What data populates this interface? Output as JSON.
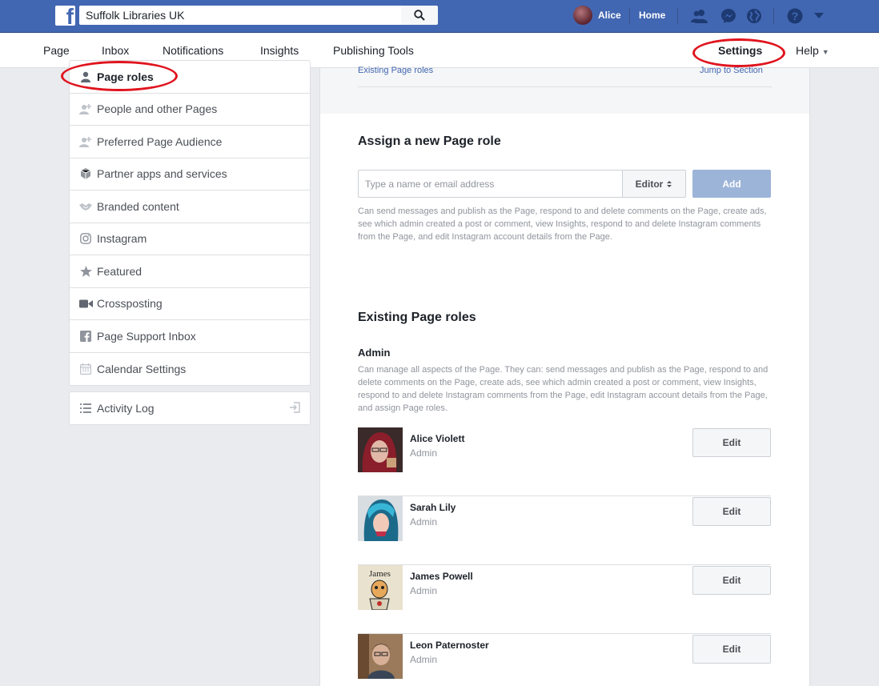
{
  "topbar": {
    "search_value": "Suffolk Libraries UK",
    "user_name": "Alice",
    "home_label": "Home"
  },
  "pagenav": {
    "tabs": [
      "Page",
      "Inbox",
      "Notifications",
      "Insights",
      "Publishing Tools"
    ],
    "settings_label": "Settings",
    "help_label": "Help"
  },
  "sidebar": {
    "items": [
      {
        "label": "Page roles",
        "icon": "person-icon"
      },
      {
        "label": "People and other Pages",
        "icon": "people-add-icon"
      },
      {
        "label": "Preferred Page Audience",
        "icon": "people-add-icon"
      },
      {
        "label": "Partner apps and services",
        "icon": "cube-icon"
      },
      {
        "label": "Branded content",
        "icon": "handshake-icon"
      },
      {
        "label": "Instagram",
        "icon": "instagram-icon"
      },
      {
        "label": "Featured",
        "icon": "star-icon"
      },
      {
        "label": "Crossposting",
        "icon": "video-icon"
      },
      {
        "label": "Page Support Inbox",
        "icon": "facebook-square-icon"
      },
      {
        "label": "Calendar Settings",
        "icon": "calendar-icon"
      }
    ],
    "activity_log": "Activity Log"
  },
  "main": {
    "top_link_left": "Existing Page roles",
    "top_link_right": "Jump to Section",
    "assign": {
      "title": "Assign a new Page role",
      "placeholder": "Type a name or email address",
      "role_selected": "Editor",
      "add_label": "Add",
      "description": "Can send messages and publish as the Page, respond to and delete comments on the Page, create ads, see which admin created a post or comment, view Insights, respond to and delete Instagram comments from the Page, and edit Instagram account details from the Page."
    },
    "existing": {
      "title": "Existing Page roles",
      "group_title": "Admin",
      "group_description": "Can manage all aspects of the Page. They can: send messages and publish as the Page, respond to and delete comments on the Page, create ads, see which admin created a post or comment, view Insights, respond to and delete Instagram comments from the Page, edit Instagram account details from the Page, and assign Page roles.",
      "people": [
        {
          "name": "Alice Violett",
          "role": "Admin",
          "edit": "Edit"
        },
        {
          "name": "Sarah Lily",
          "role": "Admin",
          "edit": "Edit"
        },
        {
          "name": "James Powell",
          "role": "Admin",
          "edit": "Edit"
        },
        {
          "name": "Leon Paternoster",
          "role": "Admin",
          "edit": "Edit"
        }
      ]
    }
  }
}
